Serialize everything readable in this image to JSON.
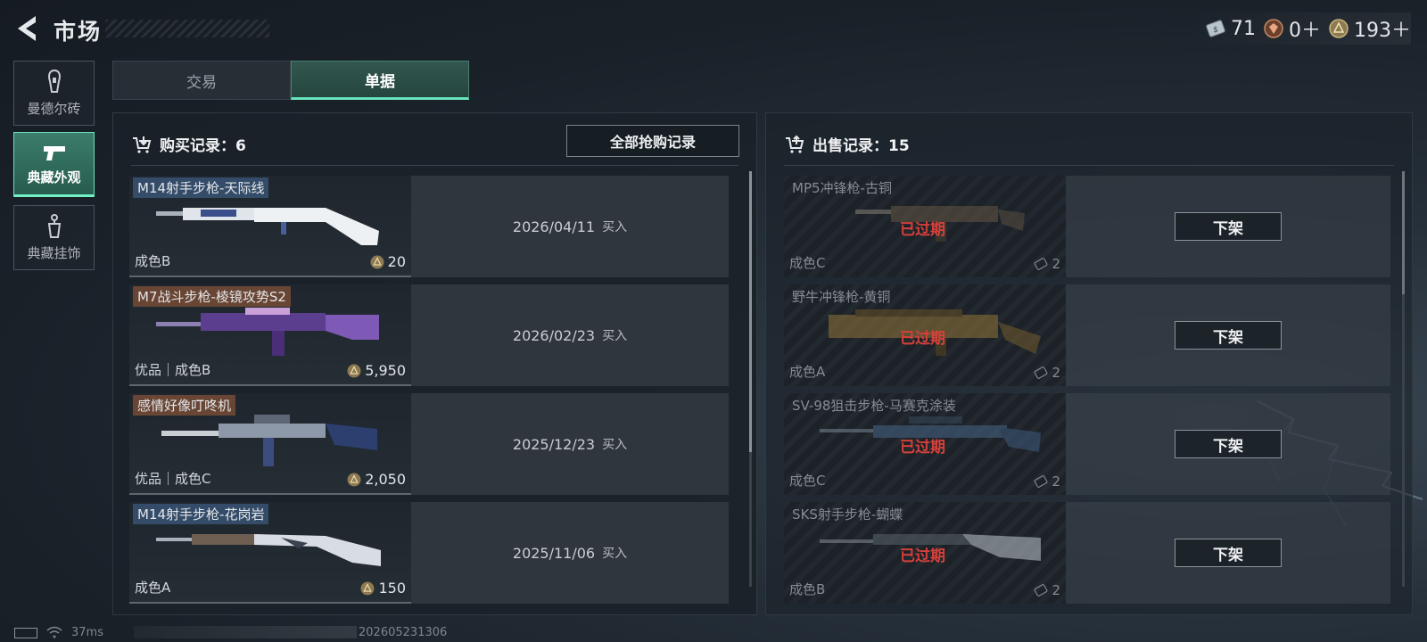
{
  "header": {
    "title": "市场"
  },
  "currencies": [
    {
      "icon": "ticket-icon",
      "value": "71"
    },
    {
      "icon": "gem-icon",
      "value": "0＋"
    },
    {
      "icon": "coin-icon",
      "value": "193＋"
    }
  ],
  "sidebar": {
    "items": [
      {
        "label": "曼德尔砖",
        "icon": "mandel-brick-icon"
      },
      {
        "label": "典藏外观",
        "icon": "pistol-icon",
        "active": true
      },
      {
        "label": "典藏挂饰",
        "icon": "charm-icon"
      }
    ]
  },
  "tabs": [
    {
      "label": "交易"
    },
    {
      "label": "单据",
      "active": true
    }
  ],
  "purchase": {
    "title": "购买记录：6",
    "all_button": "全部抢购记录",
    "rows": [
      {
        "name": "M14射手步枪-天际线",
        "tag": "blue",
        "quality": "成色B",
        "price": "20",
        "date": "2026/04/11",
        "action": "买入"
      },
      {
        "name": "M7战斗步枪-棱镜攻势S2",
        "tag": "orange",
        "quality": "优品｜成色B",
        "price": "5,950",
        "date": "2026/02/23",
        "action": "买入"
      },
      {
        "name": "感情好像叮咚机",
        "tag": "orange",
        "quality": "优品｜成色C",
        "price": "2,050",
        "date": "2025/12/23",
        "action": "买入"
      },
      {
        "name": "M14射手步枪-花岗岩",
        "tag": "blue",
        "quality": "成色A",
        "price": "150",
        "date": "2025/11/06",
        "action": "买入"
      }
    ]
  },
  "sales": {
    "title": "出售记录：15",
    "rows": [
      {
        "name": "MP5冲锋枪-古铜",
        "quality": "成色C",
        "price": "2",
        "status": "已过期",
        "button": "下架"
      },
      {
        "name": "野牛冲锋枪-黄铜",
        "quality": "成色A",
        "price": "2",
        "status": "已过期",
        "button": "下架"
      },
      {
        "name": "SV-98狙击步枪-马赛克涂装",
        "quality": "成色C",
        "price": "2",
        "status": "已过期",
        "button": "下架"
      },
      {
        "name": "SKS射手步枪-蝴蝶",
        "quality": "成色B",
        "price": "2",
        "status": "已过期",
        "button": "下架"
      }
    ]
  },
  "status_bar": {
    "ping": "37ms",
    "build": "202605231306"
  },
  "colors": {
    "accent": "#67e4bb",
    "expired": "#e0423b",
    "active_tab": "#24453e"
  }
}
